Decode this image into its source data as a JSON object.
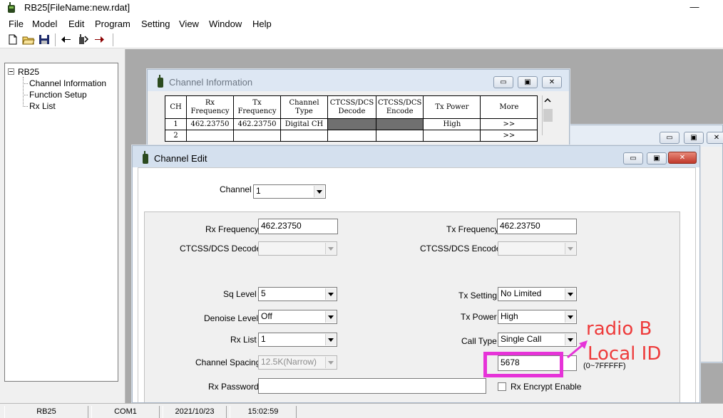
{
  "app": {
    "title": "RB25[FileName:new.rdat]",
    "minimize_glyph": "—"
  },
  "menu": [
    "File",
    "Model",
    "Edit",
    "Program",
    "Setting",
    "View",
    "Window",
    "Help"
  ],
  "toolbar": {
    "buttons": [
      "new-file-icon",
      "open-folder-icon",
      "save-disk-icon",
      "read-from-radio-icon",
      "program-radio-icon",
      "write-to-radio-icon"
    ]
  },
  "tree": {
    "root": "RB25",
    "items": [
      "Channel Information",
      "Function Setup",
      "Rx List"
    ]
  },
  "channel_info": {
    "title": "Channel Information",
    "headers": [
      "CH",
      "Rx\nFrequency",
      "Tx\nFrequency",
      "Channel\nType",
      "CTCSS/DCS\nDecode",
      "CTCSS/DCS\nEncode",
      "Tx Power",
      "More"
    ],
    "rows": [
      {
        "ch": "1",
        "rx": "462.23750",
        "tx": "462.23750",
        "type": "Digital CH",
        "decode": "",
        "encode": "",
        "power": "High",
        "more": ">>"
      },
      {
        "ch": "2",
        "rx": "",
        "tx": "",
        "type": "",
        "decode": "",
        "encode": "",
        "power": "",
        "more": ">>"
      }
    ]
  },
  "channel_edit": {
    "title": "Channel Edit",
    "channel": {
      "label": "Channel",
      "value": "1"
    },
    "rx_frequency": {
      "label": "Rx Frequency",
      "value": "462.23750"
    },
    "tx_frequency": {
      "label": "Tx Frequency",
      "value": "462.23750"
    },
    "ctcss_decode": {
      "label": "CTCSS/DCS Decode",
      "value": ""
    },
    "ctcss_encode": {
      "label": "CTCSS/DCS Encode",
      "value": ""
    },
    "sq_level": {
      "label": "Sq Level",
      "value": "5"
    },
    "tx_setting": {
      "label": "Tx Setting",
      "value": "No Limited"
    },
    "denoise_level": {
      "label": "Denoise Level",
      "value": "Off"
    },
    "tx_power": {
      "label": "Tx Power",
      "value": "High"
    },
    "rx_list": {
      "label": "Rx List",
      "value": "1"
    },
    "call_type": {
      "label": "Call Type",
      "value": "Single Call"
    },
    "channel_spacing": {
      "label": "Channel Spacing",
      "value": "12.5K(Narrow)"
    },
    "local_id": {
      "value": "5678",
      "range": "(0~7FFFFF)"
    },
    "rx_password": {
      "label": "Rx Password",
      "value": ""
    },
    "rx_encrypt": {
      "label": "Rx Encrypt Enable",
      "checked": false
    }
  },
  "status": [
    "RB25",
    "COM1",
    "2021/10/23",
    "15:02:59"
  ],
  "annotation": {
    "line1": "radio B",
    "line2": "Local ID",
    "color": "#e633d8"
  }
}
